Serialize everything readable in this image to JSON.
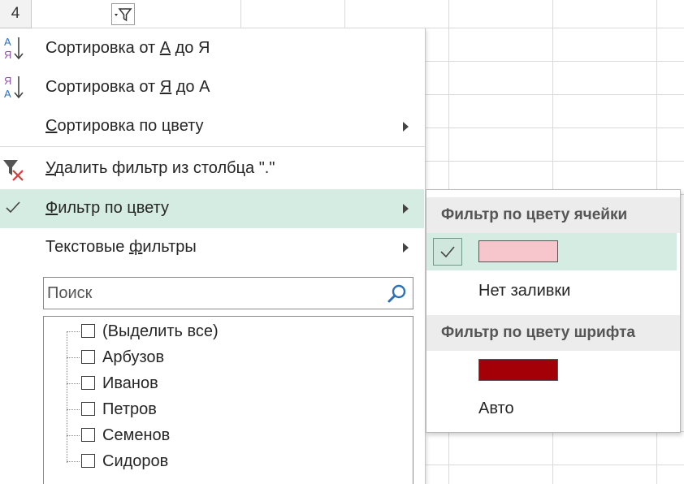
{
  "cell": {
    "row_number": "4"
  },
  "menu": {
    "sort_az": {
      "prefix": "Сортировка от ",
      "k1": "А",
      "mid": " до ",
      "k2": "Я"
    },
    "sort_za": {
      "prefix": "Сортировка от ",
      "k1": "Я",
      "mid": " до ",
      "k2": "А"
    },
    "sort_color": {
      "k": "С",
      "rest": "ортировка по цвету"
    },
    "clear_filter": {
      "k": "У",
      "rest": "далить фильтр из столбца \".\""
    },
    "filter_color": {
      "k": "Ф",
      "rest": "ильтр по цвету"
    },
    "text_filters": {
      "a": "Текстовые ",
      "k": "ф",
      "b": "ильтры"
    },
    "search_placeholder": "Поиск",
    "values": [
      {
        "label": "(Выделить все)",
        "checked": false
      },
      {
        "label": "Арбузов",
        "checked": false
      },
      {
        "label": "Иванов",
        "checked": false
      },
      {
        "label": "Петров",
        "checked": false
      },
      {
        "label": "Семенов",
        "checked": false
      },
      {
        "label": "Сидоров",
        "checked": false
      }
    ]
  },
  "submenu": {
    "cell_color_header": "Фильтр по цвету ячейки",
    "cell_colors": [
      {
        "color": "#f7c6cd",
        "selected": true
      }
    ],
    "no_fill": "Нет заливки",
    "font_color_header": "Фильтр по цвету шрифта",
    "font_colors": [
      {
        "color": "#a30008"
      }
    ],
    "auto": "Авто"
  },
  "colors": {
    "highlight": "#d5ece2",
    "sort_icon_blue": "#2f6fb8",
    "sort_icon_purple": "#8e4fa8",
    "clear_x": "#d93a3a"
  }
}
